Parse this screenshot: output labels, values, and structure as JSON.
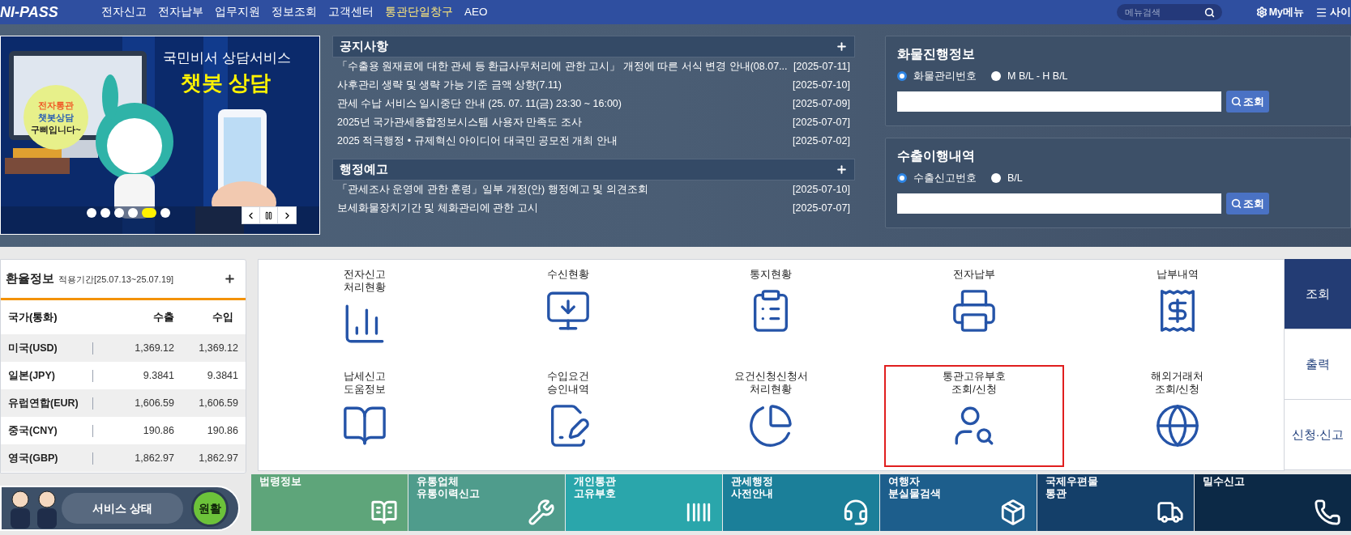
{
  "nav": {
    "logo": "NI-PASS",
    "menu": [
      {
        "label": "전자신고",
        "selected": false
      },
      {
        "label": "전자납부",
        "selected": false
      },
      {
        "label": "업무지원",
        "selected": false
      },
      {
        "label": "정보조회",
        "selected": false
      },
      {
        "label": "고객센터",
        "selected": false
      },
      {
        "label": "통관단일창구",
        "selected": true
      },
      {
        "label": "AEO",
        "selected": false
      }
    ],
    "search": {
      "placeholder": "메뉴검색"
    },
    "my_menu": "My메뉴",
    "sitemap": "사이"
  },
  "banner": {
    "headline": "국민비서 상담서비스",
    "title": "챗봇 상담",
    "bubble": [
      "전자통관",
      "챗봇상담",
      "구삐입니다~"
    ],
    "slides": [
      {
        "selected": false
      },
      {
        "selected": false
      },
      {
        "selected": false
      },
      {
        "selected": false
      },
      {
        "selected": true
      },
      {
        "selected": false
      }
    ]
  },
  "notices": [
    {
      "title": "공지사항",
      "items": [
        {
          "text": "「수출용 원재료에 대한 관세 등 환급사무처리에 관한 고시」 개정에 따른 서식 변경 안내(08.07...",
          "date": "[2025-07-11]"
        },
        {
          "text": "사후관리 생략 및 생략 가능 기준 금액 상향(7.11)",
          "date": "[2025-07-10]"
        },
        {
          "text": "관세 수납 서비스 일시중단 안내 (25. 07. 11(금) 23:30 ~ 16:00)",
          "date": "[2025-07-09]"
        },
        {
          "text": "2025년 국가관세종합정보시스템 사용자 만족도 조사",
          "date": "[2025-07-07]"
        },
        {
          "text": "2025 적극행정 • 규제혁신 아이디어 대국민 공모전 개최 안내",
          "date": "[2025-07-02]"
        }
      ]
    },
    {
      "title": "행정예고",
      "items": [
        {
          "text": "「관세조사 운영에 관한 훈령」일부 개정(안) 행정예고 및 의견조회",
          "date": "[2025-07-10]"
        },
        {
          "text": "보세화물장치기간 및 체화관리에 관한 고시",
          "date": "[2025-07-07]"
        }
      ]
    }
  ],
  "lookups": [
    {
      "title": "화물진행정보",
      "options": [
        {
          "label": "화물관리번호",
          "selected": true
        },
        {
          "label": "M B/L - H B/L",
          "selected": false
        }
      ],
      "button": "조회"
    },
    {
      "title": "수출이행내역",
      "options": [
        {
          "label": "수출신고번호",
          "selected": true
        },
        {
          "label": "B/L",
          "selected": false
        }
      ],
      "button": "조회"
    }
  ],
  "exchange": {
    "title": "환율정보",
    "period": "적용기간[25.07.13~25.07.19]",
    "columns": [
      "국가(통화)",
      "수출",
      "수입"
    ],
    "rows": [
      {
        "country": "미국(USD)",
        "export": "1,369.12",
        "import": "1,369.12"
      },
      {
        "country": "일본(JPY)",
        "export": "9.3841",
        "import": "9.3841"
      },
      {
        "country": "유럽연합(EUR)",
        "export": "1,606.59",
        "import": "1,606.59"
      },
      {
        "country": "중국(CNY)",
        "export": "190.86",
        "import": "190.86"
      },
      {
        "country": "영국(GBP)",
        "export": "1,862.97",
        "import": "1,862.97"
      }
    ]
  },
  "services": [
    {
      "lines": [
        "전자신고",
        "처리현황"
      ],
      "highlighted": false
    },
    {
      "lines": [
        "수신현황"
      ],
      "highlighted": false
    },
    {
      "lines": [
        "통지현황"
      ],
      "highlighted": false
    },
    {
      "lines": [
        "전자납부"
      ],
      "highlighted": false
    },
    {
      "lines": [
        "납부내역"
      ],
      "highlighted": false
    },
    {
      "lines": [
        "납세신고",
        "도움정보"
      ],
      "highlighted": false
    },
    {
      "lines": [
        "수입요건",
        "승인내역"
      ],
      "highlighted": false
    },
    {
      "lines": [
        "요건신청신청서",
        "처리현황"
      ],
      "highlighted": false
    },
    {
      "lines": [
        "통관고유부호",
        "조회/신청"
      ],
      "highlighted": true
    },
    {
      "lines": [
        "해외거래처",
        "조회/신청"
      ],
      "highlighted": false
    }
  ],
  "side_tabs": [
    {
      "label": "조회",
      "selected": true
    },
    {
      "label": "출력",
      "selected": false
    },
    {
      "label": "신청·신고",
      "selected": false
    }
  ],
  "status": {
    "label": "서비스 상태",
    "value": "원활"
  },
  "tiles": [
    {
      "lines": [
        "법령정보"
      ],
      "color": "#5ea57a"
    },
    {
      "lines": [
        "유통업체",
        "유통이력신고"
      ],
      "color": "#4f9c8c"
    },
    {
      "lines": [
        "개인통관",
        "고유부호"
      ],
      "color": "#2aa6ab"
    },
    {
      "lines": [
        "관세행정",
        "사전안내"
      ],
      "color": "#1b7f99"
    },
    {
      "lines": [
        "여행자",
        "분실물검색"
      ],
      "color": "#1d5e8c"
    },
    {
      "lines": [
        "국제우편물",
        "통관"
      ],
      "color": "#143f69"
    },
    {
      "lines": [
        "밀수신고"
      ],
      "color": "#0c2946"
    }
  ]
}
